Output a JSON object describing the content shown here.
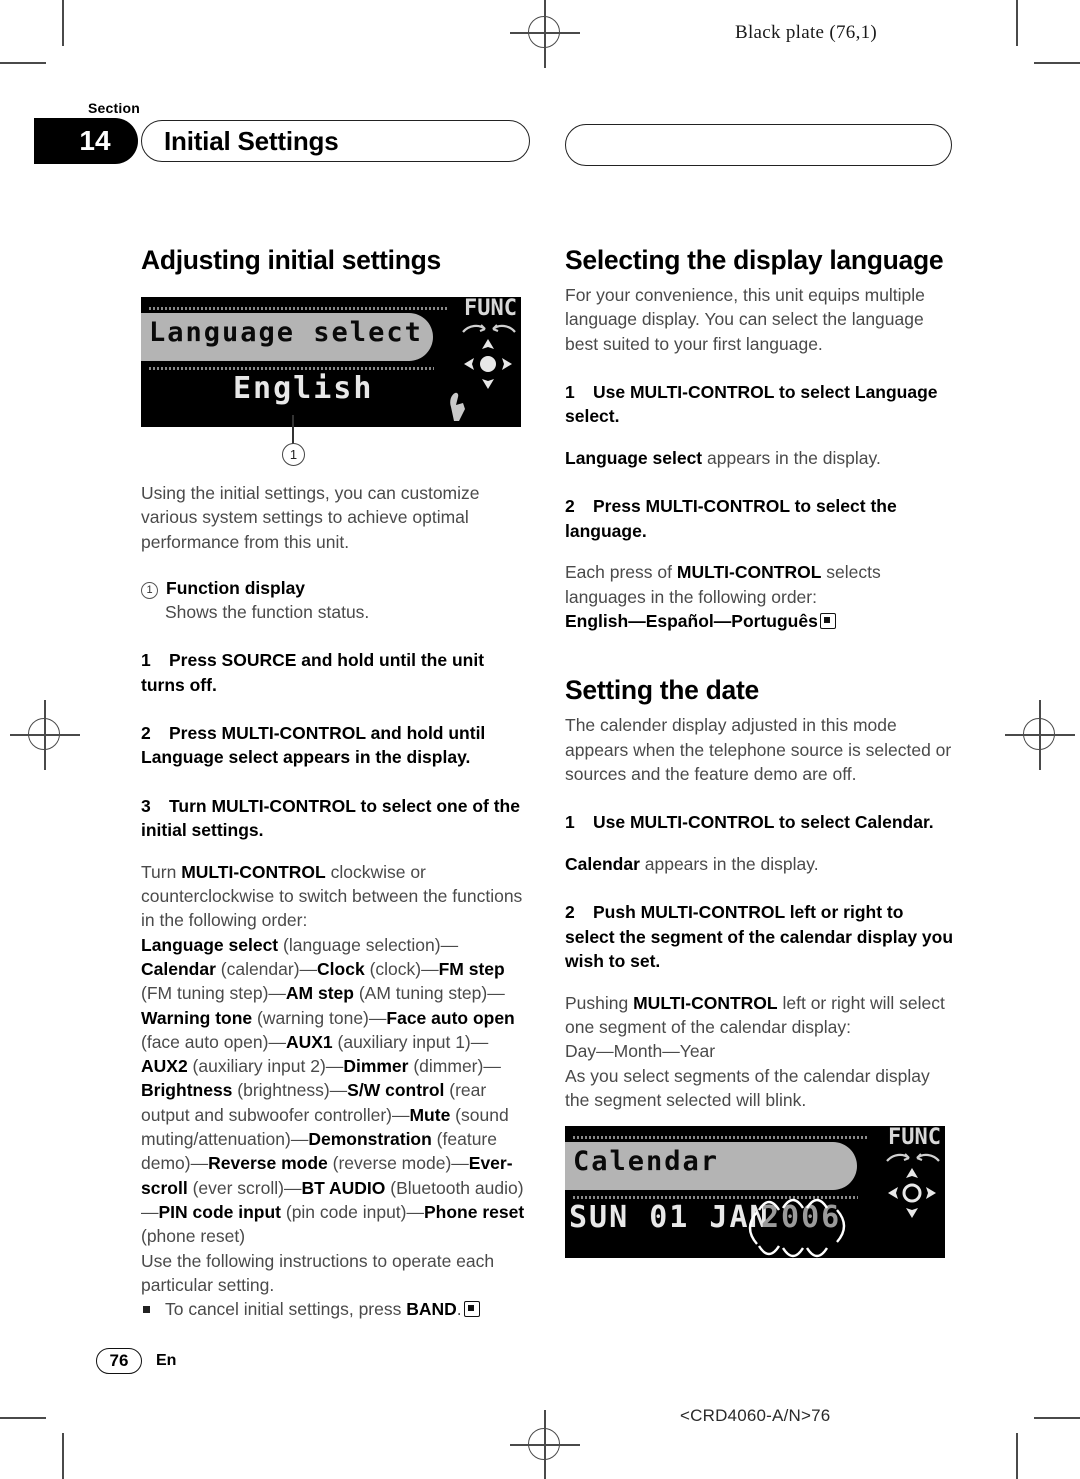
{
  "plate": {
    "label": "Black plate (76,1)"
  },
  "header": {
    "section_word": "Section",
    "section_number": "14",
    "title": "Initial Settings",
    "right_pill_title": ""
  },
  "left_column": {
    "heading": "Adjusting initial settings",
    "figure": {
      "func_label": "FUNC",
      "pill_text": "Language select",
      "bottom_text": "English",
      "callout_number": "1"
    },
    "intro": "Using the initial settings, you can customize various system settings to achieve optimal performance from this unit.",
    "callout": {
      "number": "1",
      "label": "Function display",
      "description": "Shows the function status."
    },
    "steps": [
      {
        "num": "1",
        "text": "Press SOURCE and hold until the unit turns off."
      },
      {
        "num": "2",
        "text": "Press MULTI-CONTROL and hold until Language select appears in the display."
      },
      {
        "num": "3",
        "text": "Turn MULTI-CONTROL to select one of the initial settings."
      }
    ],
    "order_intro_1": "Turn ",
    "order_intro_bold": "MULTI-CONTROL",
    "order_intro_2": " clockwise or counterclockwise to switch between the functions in the following order:",
    "order_list": [
      {
        "bold": "Language select",
        "plain": " (language selection)—"
      },
      {
        "bold": "Calendar",
        "plain": " (calendar)—"
      },
      {
        "bold": "Clock",
        "plain": " (clock)—"
      },
      {
        "bold": "FM step",
        "plain": " (FM tuning step)—"
      },
      {
        "bold": "AM step",
        "plain": " (AM tuning step)—"
      },
      {
        "bold": "Warning tone",
        "plain": " (warning tone)—"
      },
      {
        "bold": "Face auto open",
        "plain": " (face auto open)—"
      },
      {
        "bold": "AUX1",
        "plain": " (auxiliary input 1)—"
      },
      {
        "bold": "AUX2",
        "plain": " (auxiliary input 2)—"
      },
      {
        "bold": "Dimmer",
        "plain": " (dimmer)—"
      },
      {
        "bold": "Brightness",
        "plain": " (brightness)—"
      },
      {
        "bold": "S/W control",
        "plain": " (rear output and subwoofer controller)—"
      },
      {
        "bold": "Mute",
        "plain": " (sound muting/attenuation)—"
      },
      {
        "bold": "Demonstration",
        "plain": " (feature demo)—"
      },
      {
        "bold": "Reverse mode",
        "plain": " (reverse mode)—"
      },
      {
        "bold": "Ever-scroll",
        "plain": " (ever scroll)—"
      },
      {
        "bold": "BT AUDIO",
        "plain": " (Bluetooth audio)—"
      },
      {
        "bold": "PIN code input",
        "plain": " (pin code input)—"
      },
      {
        "bold": "Phone reset",
        "plain": " (phone reset)"
      }
    ],
    "order_outro": "Use the following instructions to operate each particular setting.",
    "note": {
      "text_1": "To cancel initial settings, press ",
      "bold": "BAND",
      "text_2": "."
    }
  },
  "right_column": {
    "language_section": {
      "heading": "Selecting the display language",
      "intro": "For your convenience, this unit equips multiple language display. You can select the language best suited to your first language.",
      "steps": [
        {
          "num": "1",
          "text": "Use MULTI-CONTROL to select Language select."
        },
        {
          "num": "2",
          "text": "Press MULTI-CONTROL to select the language."
        }
      ],
      "step1_sub_bold": "Language select",
      "step1_sub_plain": " appears in the display.",
      "step2_sub_1": "Each press of ",
      "step2_sub_bold": "MULTI-CONTROL",
      "step2_sub_2": " selects languages in the following order:",
      "language_order": "English—Español—Português"
    },
    "date_section": {
      "heading": "Setting the date",
      "intro": "The calender display adjusted in this mode appears when the telephone source is selected or sources and the feature demo are off.",
      "steps": [
        {
          "num": "1",
          "text": "Use MULTI-CONTROL to select Calendar."
        },
        {
          "num": "2",
          "text": "Push MULTI-CONTROL left or right to select the segment of the calendar display you wish to set."
        }
      ],
      "step1_sub_bold": "Calendar",
      "step1_sub_plain": " appears in the display.",
      "step2_sub_1": "Pushing ",
      "step2_sub_bold": "MULTI-CONTROL",
      "step2_sub_2": " left or right will select one segment of the calendar display:",
      "segment_order": "Day—Month—Year",
      "step2_sub_3": "As you select segments of the calendar display the segment selected will blink.",
      "figure": {
        "func_label": "FUNC",
        "pill_text": "Calendar",
        "bottom_text": "SUN 01 JAN",
        "blink_text": "2006"
      }
    }
  },
  "footer": {
    "page_number": "76",
    "language_code": "En",
    "part_number": "<CRD4060-A/N>76"
  }
}
